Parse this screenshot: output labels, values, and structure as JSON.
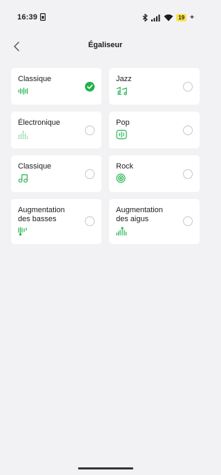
{
  "status_bar": {
    "time": "16:39",
    "battery": "19"
  },
  "header": {
    "title": "Égaliseur",
    "back_icon": "chevron-left-icon"
  },
  "presets": [
    {
      "label": "Classique",
      "icon": "waveform-icon",
      "selected": true
    },
    {
      "label": "Jazz",
      "icon": "music-notes-icon",
      "selected": false
    },
    {
      "label": "Électronique",
      "icon": "equalizer-bars-icon",
      "selected": false
    },
    {
      "label": "Pop",
      "icon": "waveform-box-icon",
      "selected": false
    },
    {
      "label": "Classique",
      "icon": "music-note-icon",
      "selected": false
    },
    {
      "label": "Rock",
      "icon": "vinyl-disc-icon",
      "selected": false
    },
    {
      "label": "Augmentation des basses",
      "icon": "bass-boost-icon",
      "selected": false
    },
    {
      "label": "Augmentation des aigus",
      "icon": "treble-boost-icon",
      "selected": false
    }
  ],
  "colors": {
    "accent": "#22b14c",
    "background": "#f2f2f4",
    "card": "#ffffff",
    "battery": "#f7e24a"
  }
}
